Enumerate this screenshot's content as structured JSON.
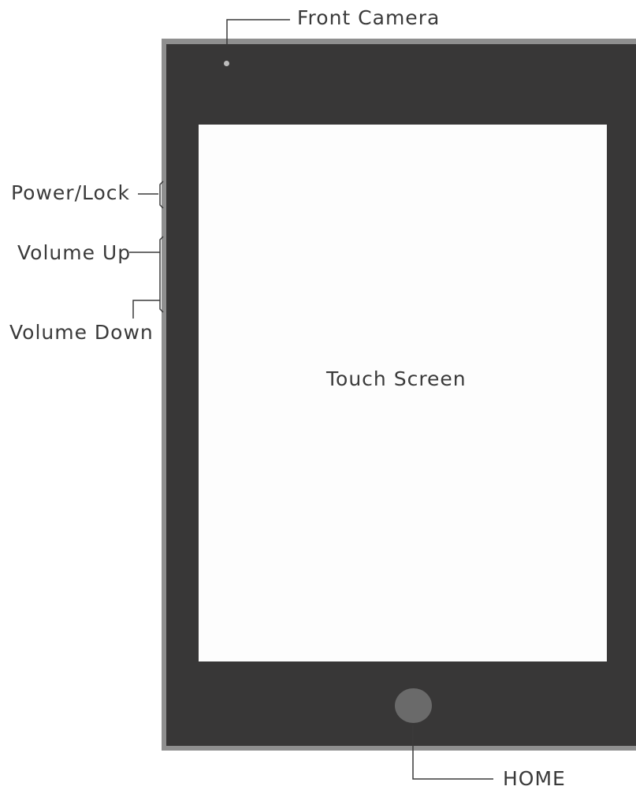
{
  "diagram": {
    "labels": {
      "front_camera": "Front Camera",
      "power_lock": "Power/Lock",
      "volume_up": "Volume Up",
      "volume_down": "Volume Down",
      "touch_screen": "Touch Screen",
      "home": "HOME"
    },
    "colors": {
      "bezel": "#383737",
      "frame": "#8f8f8f",
      "screen": "#fdfdfd",
      "home_button": "#6a6a6a",
      "camera": "#bdbdbd",
      "text": "#3a3a3a"
    }
  }
}
